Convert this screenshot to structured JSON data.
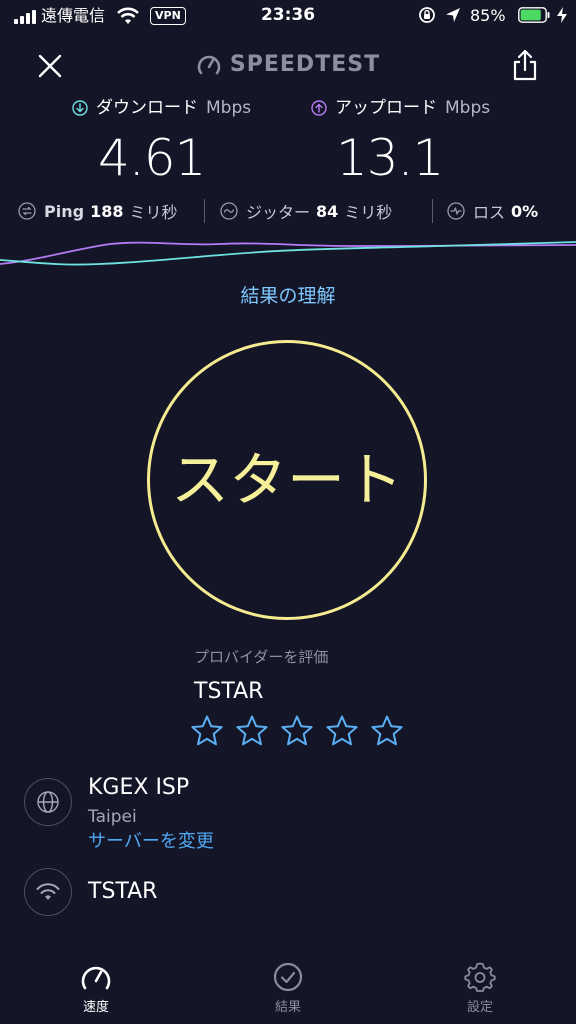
{
  "status_bar": {
    "carrier": "遠傳電信",
    "vpn": "VPN",
    "time": "23:36",
    "battery": "85%",
    "battery_level": 0.85
  },
  "header": {
    "brand": "SPEEDTEST"
  },
  "metrics": {
    "download": {
      "label": "ダウンロード",
      "unit": "Mbps",
      "value": "4.61"
    },
    "upload": {
      "label": "アップロード",
      "unit": "Mbps",
      "value": "13.1"
    }
  },
  "stats": {
    "ping": {
      "label": "Ping",
      "value": "188",
      "unit": "ミリ秒"
    },
    "jitter": {
      "label": "ジッター",
      "value": "84",
      "unit": "ミリ秒"
    },
    "loss": {
      "label": "ロス",
      "value": "0%"
    }
  },
  "links": {
    "understand_results": "結果の理解",
    "change_server": "サーバーを変更"
  },
  "start": {
    "label": "スタート"
  },
  "provider_rating": {
    "label": "プロバイダーを評価",
    "provider": "TSTAR",
    "stars_total": 5,
    "stars_filled": 0
  },
  "server": {
    "name": "KGEX ISP",
    "city": "Taipei"
  },
  "isp": {
    "name": "TSTAR"
  },
  "nav": {
    "items": [
      {
        "label": "速度",
        "active": true
      },
      {
        "label": "結果",
        "active": false
      },
      {
        "label": "設定",
        "active": false
      }
    ]
  },
  "colors": {
    "background": "#141526",
    "download_accent": "#6fe3e1",
    "upload_accent": "#b57bf5",
    "start_ring": "#f5ec91",
    "link": "#4fa8f4",
    "star": "#5ab0f5"
  },
  "icons": {
    "close": "close-icon",
    "share": "share-icon",
    "logo": "speedometer-icon",
    "download": "arrow-down-circle-icon",
    "upload": "arrow-up-circle-icon",
    "ping": "ping-icon",
    "jitter": "jitter-icon",
    "loss": "loss-icon",
    "server": "globe-icon",
    "isp": "wifi-icon",
    "nav_speed": "speedometer-icon",
    "nav_results": "check-circle-icon",
    "nav_settings": "gear-icon"
  }
}
